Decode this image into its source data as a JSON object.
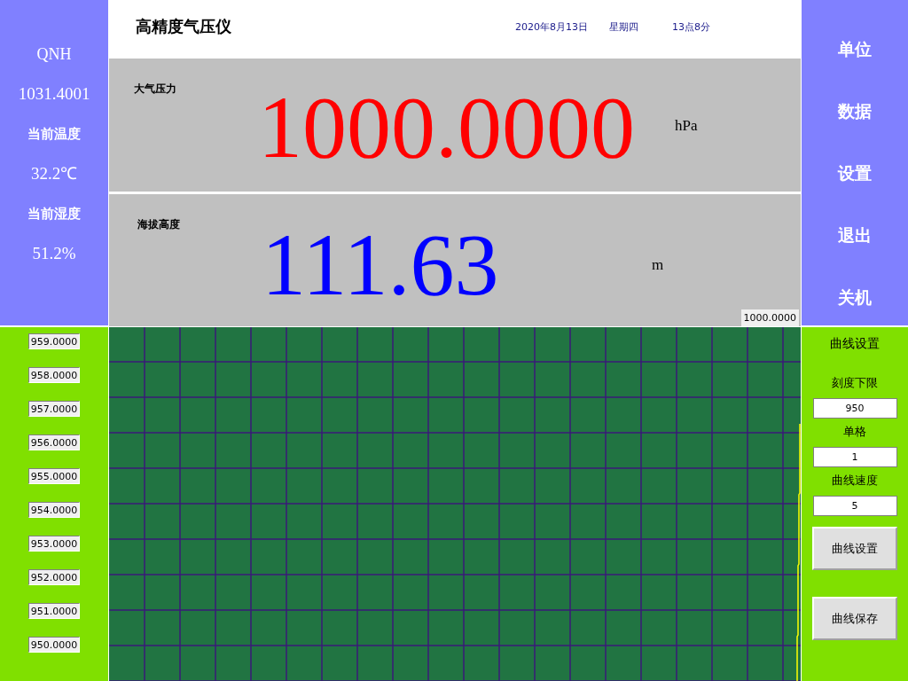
{
  "left_panel": {
    "qnh_label": "QNH",
    "qnh_value": "1031.4001",
    "temperature_label": "当前温度",
    "temperature_value": "32.2℃",
    "humidity_label": "当前湿度",
    "humidity_value": "51.2%"
  },
  "header": {
    "title": "高精度气压仪",
    "date": "2020年8月13日",
    "weekday": "星期四",
    "time": "13点8分"
  },
  "pressure": {
    "label": "大气压力",
    "value": "1000.0000",
    "unit": "hPa"
  },
  "altitude": {
    "label": "海拔高度",
    "value": "111.63",
    "unit": "m",
    "readout": "1000.0000"
  },
  "menu": [
    "单位",
    "数据",
    "设置",
    "退出",
    "关机"
  ],
  "scale_labels": [
    "959.0000",
    "958.0000",
    "957.0000",
    "956.0000",
    "955.0000",
    "954.0000",
    "953.0000",
    "952.0000",
    "951.0000",
    "950.0000"
  ],
  "curve_settings": {
    "title": "曲线设置",
    "fields": [
      {
        "label": "刻度下限",
        "value": "950"
      },
      {
        "label": "单格",
        "value": "1"
      },
      {
        "label": "曲线速度",
        "value": "5"
      }
    ],
    "buttons": [
      "曲线设置",
      "曲线保存"
    ]
  }
}
